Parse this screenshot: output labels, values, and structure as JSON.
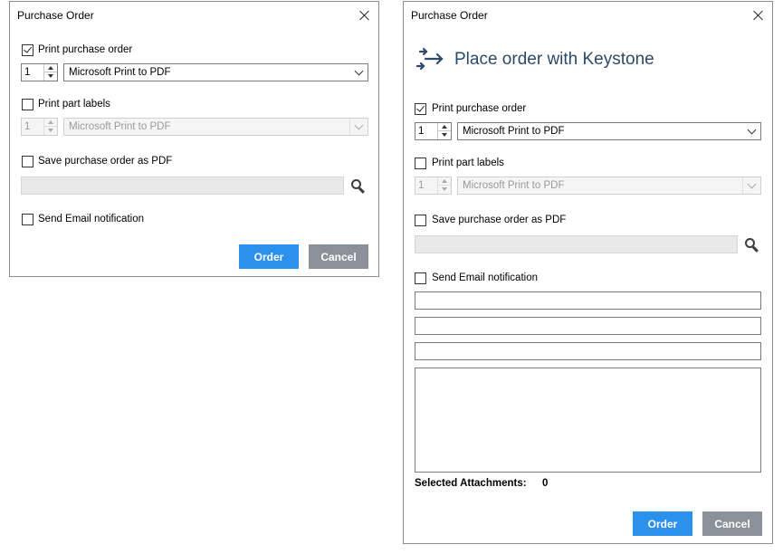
{
  "dialog1": {
    "title": "Purchase Order",
    "print_po": {
      "label": "Print purchase order",
      "checked": true,
      "copies": "1",
      "printer": "Microsoft Print to PDF"
    },
    "print_labels": {
      "label": "Print part labels",
      "checked": false,
      "copies": "1",
      "printer": "Microsoft Print to PDF"
    },
    "save_pdf": {
      "label": "Save purchase order as PDF",
      "checked": false,
      "path": ""
    },
    "email": {
      "label": "Send Email notification",
      "checked": false
    },
    "buttons": {
      "order": "Order",
      "cancel": "Cancel"
    }
  },
  "dialog2": {
    "title": "Purchase Order",
    "heading": "Place order with Keystone",
    "print_po": {
      "label": "Print purchase order",
      "checked": true,
      "copies": "1",
      "printer": "Microsoft Print to PDF"
    },
    "print_labels": {
      "label": "Print part labels",
      "checked": false,
      "copies": "1",
      "printer": "Microsoft Print to PDF"
    },
    "save_pdf": {
      "label": "Save purchase order as PDF",
      "checked": false,
      "path": ""
    },
    "email": {
      "label": "Send Email notification",
      "checked": false,
      "to": "",
      "cc": "",
      "subject": "",
      "body": ""
    },
    "attachments": {
      "label": "Selected Attachments:",
      "count": "0"
    },
    "buttons": {
      "order": "Order",
      "cancel": "Cancel"
    }
  },
  "colors": {
    "order_button": "#2b91ee",
    "cancel_button": "#8a9198",
    "heading_text": "#2b4a68"
  },
  "icons": {
    "close": "close-icon",
    "search": "search-icon",
    "keystone": "arrows-transfer-icon"
  }
}
